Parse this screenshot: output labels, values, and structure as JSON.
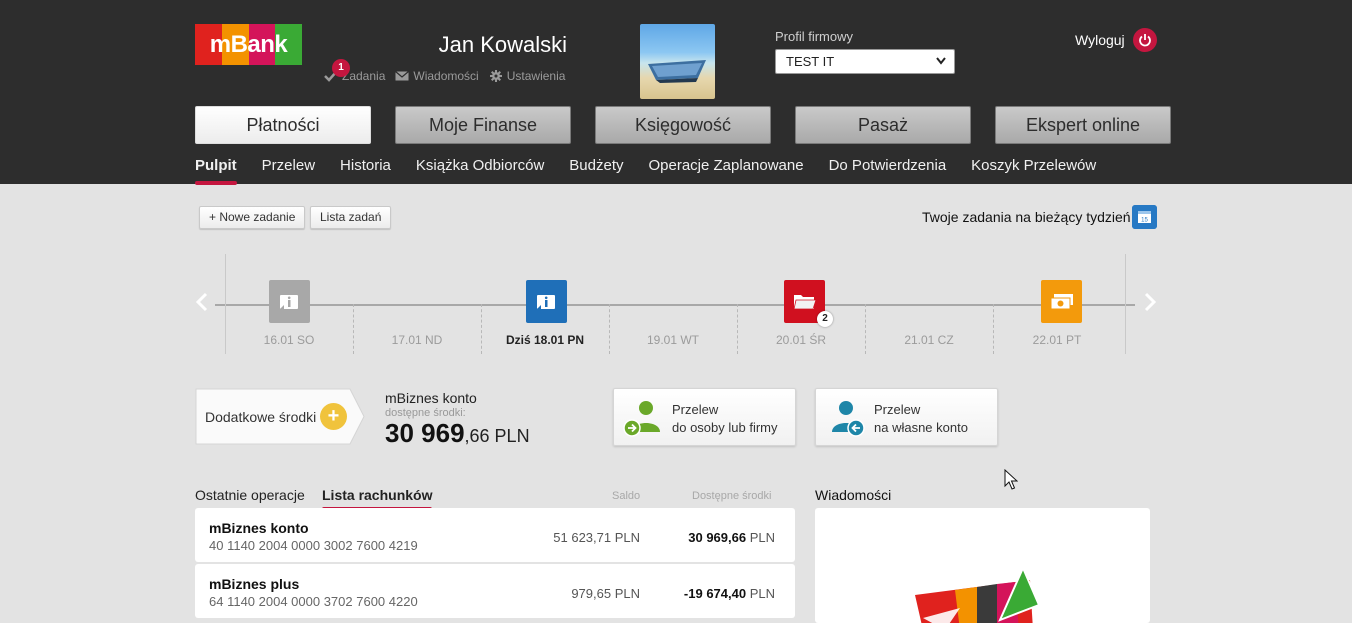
{
  "brand": {
    "logo_text": "mBank"
  },
  "user": {
    "name": "Jan Kowalski"
  },
  "quick_links": [
    {
      "label": "Zadania",
      "badge": "1",
      "icon": "check-icon"
    },
    {
      "label": "Wiadomości",
      "icon": "envelope-icon"
    },
    {
      "label": "Ustawienia",
      "icon": "gear-icon"
    }
  ],
  "profile": {
    "label": "Profil firmowy",
    "selected": "TEST IT"
  },
  "logout": {
    "label": "Wyloguj",
    "icon": "power-icon"
  },
  "main_tabs": [
    "Płatności",
    "Moje Finanse",
    "Księgowość",
    "Pasaż",
    "Ekspert online"
  ],
  "sub_nav": [
    "Pulpit",
    "Przelew",
    "Historia",
    "Książka Odbiorców",
    "Budżety",
    "Operacje Zaplanowane",
    "Do Potwierdzenia",
    "Koszyk Przelewów"
  ],
  "tasks": {
    "new_task": "+ Nowe zadanie",
    "task_list": "Lista zadań",
    "week_label": "Twoje zadania na bieżący tydzień"
  },
  "timeline": {
    "days": [
      "16.01 SO",
      "17.01 ND",
      "Dziś 18.01 PN",
      "19.01 WT",
      "20.01 ŚR",
      "21.01 CZ",
      "22.01 PT"
    ],
    "events": [
      {
        "day": "16.01 SO",
        "color": "#a8a8a8",
        "icon": "info-icon"
      },
      {
        "day": "Dziś 18.01 PN",
        "color": "#1f6fb8",
        "icon": "info-icon"
      },
      {
        "day": "20.01 ŚR",
        "color": "#d0101f",
        "icon": "folder-icon",
        "count": "2"
      },
      {
        "day": "22.01 PT",
        "color": "#f39a0c",
        "icon": "money-icon"
      }
    ]
  },
  "summary": {
    "extra_funds": "Dodatkowe środki",
    "account_name": "mBiznes konto",
    "available_label": "dostępne środki:",
    "amount_main": "30 969",
    "amount_rest": ",66 PLN"
  },
  "transfers": [
    {
      "line1": "Przelew",
      "line2": "do osoby lub firmy"
    },
    {
      "line1": "Przelew",
      "line2": "na własne konto"
    }
  ],
  "lists": {
    "tab_recent": "Ostatnie operacje",
    "tab_accounts": "Lista rachunków",
    "col_balance": "Saldo",
    "col_available": "Dostępne środki"
  },
  "accounts": [
    {
      "name": "mBiznes konto",
      "number": "40 1140 2004 0000 3002 7600 4219",
      "balance": "51 623,71 PLN",
      "available_value": "30 969,66",
      "available_currency": " PLN"
    },
    {
      "name": "mBiznes plus",
      "number": "64 1140 2004 0000 3702 7600 4220",
      "balance": "979,65 PLN",
      "available_value": "-19 674,40",
      "available_currency": " PLN"
    }
  ],
  "messages": {
    "title": "Wiadomości"
  }
}
